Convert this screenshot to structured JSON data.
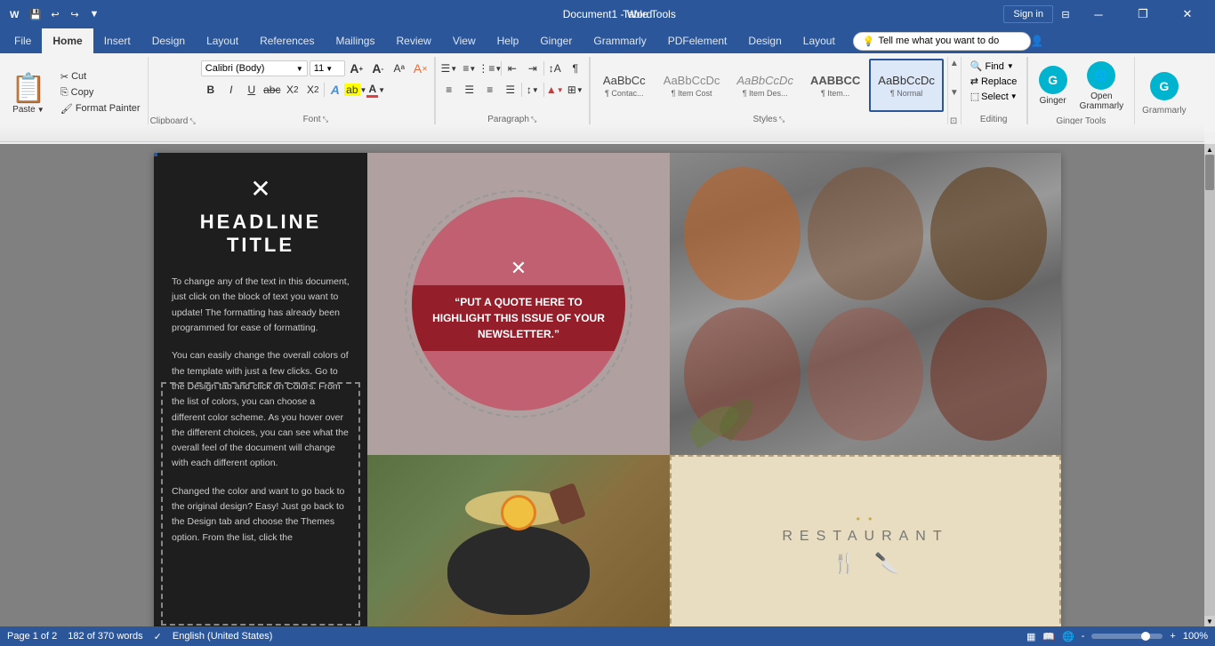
{
  "titlebar": {
    "qat": [
      "save",
      "undo",
      "redo",
      "customize"
    ],
    "title": "Document1 - Word",
    "table_tools": "Table Tools",
    "signin": "Sign in",
    "minimize": "─",
    "restore": "❐",
    "close": "✕"
  },
  "ribbon": {
    "tabs": [
      "File",
      "Home",
      "Insert",
      "Design",
      "Layout",
      "References",
      "Mailings",
      "Review",
      "View",
      "Help",
      "Ginger",
      "Grammarly",
      "PDFelement",
      "Design",
      "Layout"
    ],
    "active_tab": "Home",
    "clipboard": {
      "paste_label": "Paste",
      "cut": "Cut",
      "copy": "Copy",
      "format_painter": "Format Painter",
      "group_label": "Clipboard"
    },
    "font": {
      "family": "Calibri (Body)",
      "size": "11",
      "group_label": "Font"
    },
    "paragraph": {
      "group_label": "Paragraph"
    },
    "styles": {
      "items": [
        {
          "label": "¶ Contac...",
          "preview": "AaBbCc",
          "active": false
        },
        {
          "label": "¶ Item Cost",
          "preview": "AaBbCcDc",
          "active": false
        },
        {
          "label": "AaBbCcDc",
          "preview": "AaBbCcDc",
          "active": false
        },
        {
          "label": "AABBCC",
          "preview": "AABBCC",
          "active": false
        },
        {
          "label": "¶ AaBbCcDc",
          "preview": "AaBbCcDc",
          "active": true
        }
      ],
      "group_label": "Styles"
    },
    "editing": {
      "find": "Find",
      "replace": "Replace",
      "select": "Select",
      "group_label": "Editing"
    },
    "tell_me": "Tell me what you want to do",
    "share": "Share"
  },
  "document": {
    "headline": "HEADLINE TITLE",
    "body_paragraphs": [
      "To change any of the text in this document, just click on the block of text you want to update!  The formatting has already been programmed for ease of formatting.",
      "You can easily change the overall colors of the template with just a few clicks.  Go to the Design tab and click on Colors.  From the list of colors, you can choose a different color scheme.  As you hover over the different choices, you can see what the overall feel of the document will change with each different option.",
      "Changed the color and want to go back to the original design?  Easy!  Just go back to the Design tab and choose the Themes option.  From the list, click the"
    ],
    "quote": "“PUT A QUOTE HERE TO HIGHLIGHT THIS ISSUE OF YOUR NEWSLETTER.”",
    "restaurant_name": "RESTAURANT",
    "status": {
      "page": "Page 1 of 2",
      "words": "182 of 370 words",
      "language": "English (United States)",
      "zoom": "100%"
    }
  }
}
